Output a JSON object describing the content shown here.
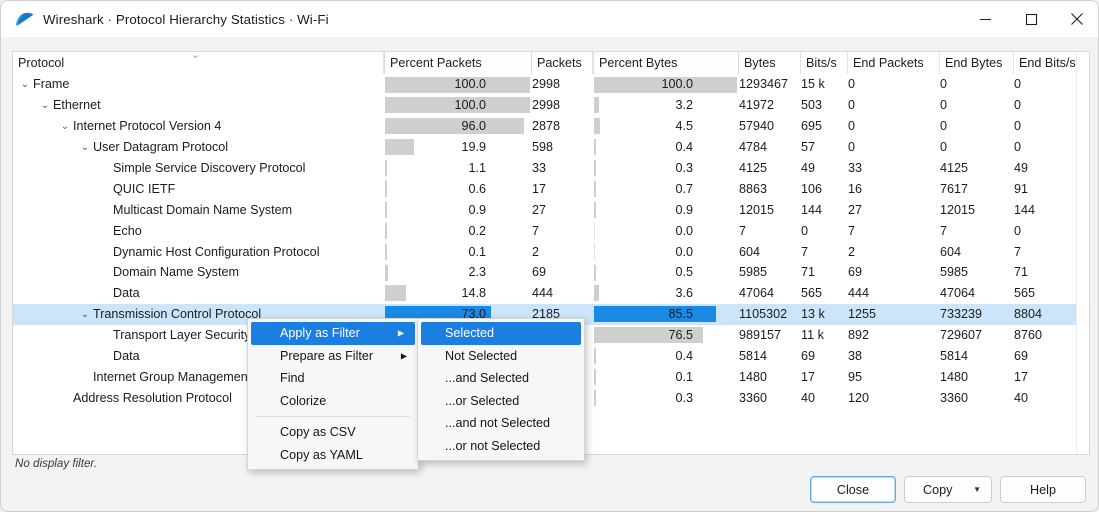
{
  "window": {
    "title": "Wireshark · Protocol Hierarchy Statistics · Wi-Fi",
    "minimize": "–",
    "maximize": "□",
    "close": "✕"
  },
  "table": {
    "columns": [
      "Protocol",
      "Percent Packets",
      "Packets",
      "Percent Bytes",
      "Bytes",
      "Bits/s",
      "End Packets",
      "End Bytes",
      "End Bits/s"
    ],
    "rows": [
      {
        "protocol": "Frame",
        "indent": 0,
        "twisty": "⌄",
        "percent_packets": "100.0",
        "pct_pk_val": 100,
        "packets": "2998",
        "percent_bytes": "100.0",
        "pct_by_val": 100,
        "bytes": "1293467",
        "bits_s": "15 k",
        "end_packets": "0",
        "end_bytes": "0",
        "end_bits_s": "0"
      },
      {
        "protocol": "Ethernet",
        "indent": 1,
        "twisty": "⌄",
        "percent_packets": "100.0",
        "pct_pk_val": 100,
        "packets": "2998",
        "percent_bytes": "3.2",
        "pct_by_val": 3.2,
        "bytes": "41972",
        "bits_s": "503",
        "end_packets": "0",
        "end_bytes": "0",
        "end_bits_s": "0"
      },
      {
        "protocol": "Internet Protocol Version 4",
        "indent": 2,
        "twisty": "⌄",
        "percent_packets": "96.0",
        "pct_pk_val": 96,
        "packets": "2878",
        "percent_bytes": "4.5",
        "pct_by_val": 4.5,
        "bytes": "57940",
        "bits_s": "695",
        "end_packets": "0",
        "end_bytes": "0",
        "end_bits_s": "0"
      },
      {
        "protocol": "User Datagram Protocol",
        "indent": 3,
        "twisty": "⌄",
        "percent_packets": "19.9",
        "pct_pk_val": 19.9,
        "packets": "598",
        "percent_bytes": "0.4",
        "pct_by_val": 0.4,
        "bytes": "4784",
        "bits_s": "57",
        "end_packets": "0",
        "end_bytes": "0",
        "end_bits_s": "0"
      },
      {
        "protocol": "Simple Service Discovery Protocol",
        "indent": 4,
        "twisty": "",
        "percent_packets": "1.1",
        "pct_pk_val": 1.1,
        "packets": "33",
        "percent_bytes": "0.3",
        "pct_by_val": 0.3,
        "bytes": "4125",
        "bits_s": "49",
        "end_packets": "33",
        "end_bytes": "4125",
        "end_bits_s": "49"
      },
      {
        "protocol": "QUIC IETF",
        "indent": 4,
        "twisty": "",
        "percent_packets": "0.6",
        "pct_pk_val": 0.6,
        "packets": "17",
        "percent_bytes": "0.7",
        "pct_by_val": 0.7,
        "bytes": "8863",
        "bits_s": "106",
        "end_packets": "16",
        "end_bytes": "7617",
        "end_bits_s": "91"
      },
      {
        "protocol": "Multicast Domain Name System",
        "indent": 4,
        "twisty": "",
        "percent_packets": "0.9",
        "pct_pk_val": 0.9,
        "packets": "27",
        "percent_bytes": "0.9",
        "pct_by_val": 0.9,
        "bytes": "12015",
        "bits_s": "144",
        "end_packets": "27",
        "end_bytes": "12015",
        "end_bits_s": "144"
      },
      {
        "protocol": "Echo",
        "indent": 4,
        "twisty": "",
        "percent_packets": "0.2",
        "pct_pk_val": 0.2,
        "packets": "7",
        "percent_bytes": "0.0",
        "pct_by_val": 0.0,
        "bytes": "7",
        "bits_s": "0",
        "end_packets": "7",
        "end_bytes": "7",
        "end_bits_s": "0"
      },
      {
        "protocol": "Dynamic Host Configuration Protocol",
        "indent": 4,
        "twisty": "",
        "percent_packets": "0.1",
        "pct_pk_val": 0.1,
        "packets": "2",
        "percent_bytes": "0.0",
        "pct_by_val": 0.0,
        "bytes": "604",
        "bits_s": "7",
        "end_packets": "2",
        "end_bytes": "604",
        "end_bits_s": "7"
      },
      {
        "protocol": "Domain Name System",
        "indent": 4,
        "twisty": "",
        "percent_packets": "2.3",
        "pct_pk_val": 2.3,
        "packets": "69",
        "percent_bytes": "0.5",
        "pct_by_val": 0.5,
        "bytes": "5985",
        "bits_s": "71",
        "end_packets": "69",
        "end_bytes": "5985",
        "end_bits_s": "71"
      },
      {
        "protocol": "Data",
        "indent": 4,
        "twisty": "",
        "percent_packets": "14.8",
        "pct_pk_val": 14.8,
        "packets": "444",
        "percent_bytes": "3.6",
        "pct_by_val": 3.6,
        "bytes": "47064",
        "bits_s": "565",
        "end_packets": "444",
        "end_bytes": "47064",
        "end_bits_s": "565"
      },
      {
        "protocol": "Transmission Control Protocol",
        "indent": 3,
        "twisty": "⌄",
        "selected": true,
        "percent_packets": "73.0",
        "pct_pk_val": 73.0,
        "packets": "2185",
        "percent_bytes": "85.5",
        "pct_by_val": 85.5,
        "bytes": "1105302",
        "bits_s": "13 k",
        "end_packets": "1255",
        "end_bytes": "733239",
        "end_bits_s": "8804"
      },
      {
        "protocol": "Transport Layer Security",
        "indent": 4,
        "twisty": "",
        "percent_packets": "",
        "pct_pk_val": 0,
        "packets": "",
        "percent_bytes": "76.5",
        "pct_by_val": 76.5,
        "bytes": "989157",
        "bits_s": "11 k",
        "end_packets": "892",
        "end_bytes": "729607",
        "end_bits_s": "8760"
      },
      {
        "protocol": "Data",
        "indent": 4,
        "twisty": "",
        "percent_packets": "",
        "pct_pk_val": 0,
        "packets": "",
        "percent_bytes": "0.4",
        "pct_by_val": 0.4,
        "bytes": "5814",
        "bits_s": "69",
        "end_packets": "38",
        "end_bytes": "5814",
        "end_bits_s": "69"
      },
      {
        "protocol": "Internet Group Management Protocol",
        "indent": 3,
        "twisty": "",
        "percent_packets": "",
        "pct_pk_val": 0,
        "packets": "",
        "percent_bytes": "0.1",
        "pct_by_val": 0.1,
        "bytes": "1480",
        "bits_s": "17",
        "end_packets": "95",
        "end_bytes": "1480",
        "end_bits_s": "17"
      },
      {
        "protocol": "Address Resolution Protocol",
        "indent": 2,
        "twisty": "",
        "percent_packets": "",
        "pct_pk_val": 0,
        "packets": "",
        "percent_bytes": "0.3",
        "pct_by_val": 0.3,
        "bytes": "3360",
        "bits_s": "40",
        "end_packets": "120",
        "end_bytes": "3360",
        "end_bits_s": "40"
      }
    ]
  },
  "context_menu": {
    "items": [
      {
        "label": "Apply as Filter",
        "submenu": true,
        "highlighted": true
      },
      {
        "label": "Prepare as Filter",
        "submenu": true,
        "highlighted": false
      },
      {
        "label": "Find",
        "submenu": false,
        "highlighted": false
      },
      {
        "label": "Colorize",
        "submenu": false,
        "highlighted": false
      },
      {
        "separator": true
      },
      {
        "label": "Copy as CSV",
        "submenu": false,
        "highlighted": false
      },
      {
        "label": "Copy as YAML",
        "submenu": false,
        "highlighted": false
      }
    ],
    "arrow_glyph": "▶"
  },
  "submenu": {
    "items": [
      {
        "label": "Selected",
        "highlighted": true
      },
      {
        "label": "Not Selected",
        "highlighted": false
      },
      {
        "label": "...and Selected",
        "highlighted": false
      },
      {
        "label": "...or Selected",
        "highlighted": false
      },
      {
        "label": "...and not Selected",
        "highlighted": false
      },
      {
        "label": "...or not Selected",
        "highlighted": false
      }
    ]
  },
  "footer": {
    "filter_status": "No display filter.",
    "close_label": "Close",
    "copy_label": "Copy",
    "copy_caret": "▼",
    "help_label": "Help"
  },
  "colors": {
    "selection_blue": "#1a8ae5",
    "row_highlight": "#cce5fb",
    "bar_gray": "#cfcfcf",
    "menu_highlight": "#1a7fe0"
  }
}
